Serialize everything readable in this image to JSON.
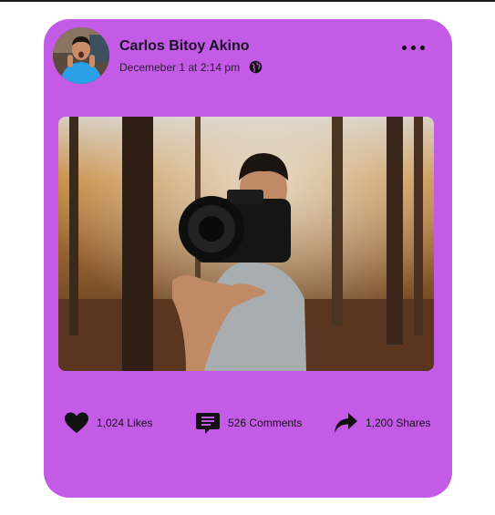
{
  "post": {
    "author": "Carlos Bitoy Akino",
    "timestamp": "Decemeber 1 at 2:14 pm",
    "privacy_icon": "globe-icon",
    "menu_icon": "more-dots-icon"
  },
  "actions": {
    "likes": {
      "icon": "heart-icon",
      "label": "1,024 Likes"
    },
    "comments": {
      "icon": "comment-icon",
      "label": "526 Comments"
    },
    "shares": {
      "icon": "share-icon",
      "label": "1,200 Shares"
    }
  },
  "colors": {
    "card": "#c45be6",
    "text": "#111111"
  }
}
